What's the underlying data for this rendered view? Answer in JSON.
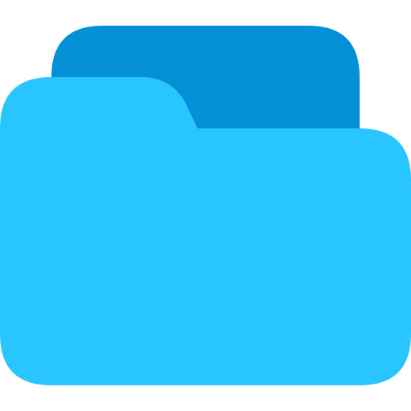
{
  "icon": {
    "name": "folder-icon",
    "colors": {
      "back": "#0390D6",
      "front": "#29C5FF",
      "background": "#FFFFFF"
    }
  }
}
